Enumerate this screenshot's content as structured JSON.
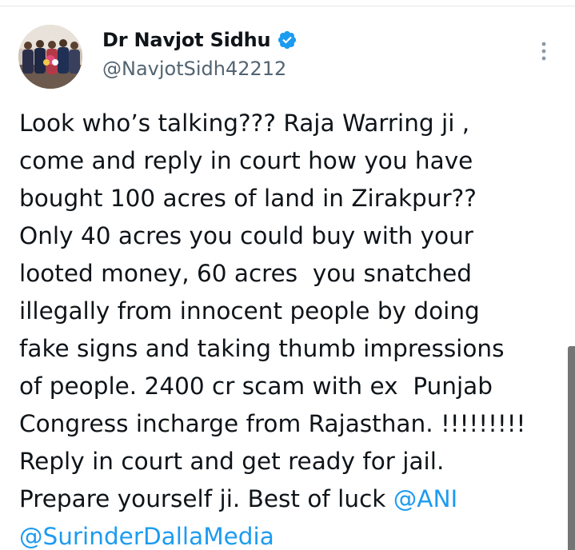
{
  "tweet": {
    "author": {
      "display_name": "Dr Navjot Sidhu",
      "handle": "@NavjotSidh42212",
      "verified": true
    },
    "more_icon": "more-vertical-icon",
    "verified_icon": "verified-badge-icon",
    "lines": [
      "Look who’s talking??? Raja Warring ji ,",
      "come and reply in court how you have",
      "bought 100 acres of land in Zirakpur??",
      "Only 40 acres you could buy with your",
      "looted money, 60 acres  you snatched",
      "illegally from innocent people by doing",
      "fake signs and taking thumb impressions",
      "of people. 2400 cr scam with ex  Punjab",
      "Congress incharge from Rajasthan. !!!!!!!!!",
      "Reply in court and get ready for jail."
    ],
    "last_line_text": "Prepare yourself ji. Best of luck ",
    "mentions": [
      "@ANI",
      "@SurinderDallaMedia"
    ]
  },
  "colors": {
    "text": "#0f1419",
    "secondary_text": "#536471",
    "link": "#1d9bf0",
    "verified": "#1d9bf0",
    "scrollbar": "#757575"
  }
}
